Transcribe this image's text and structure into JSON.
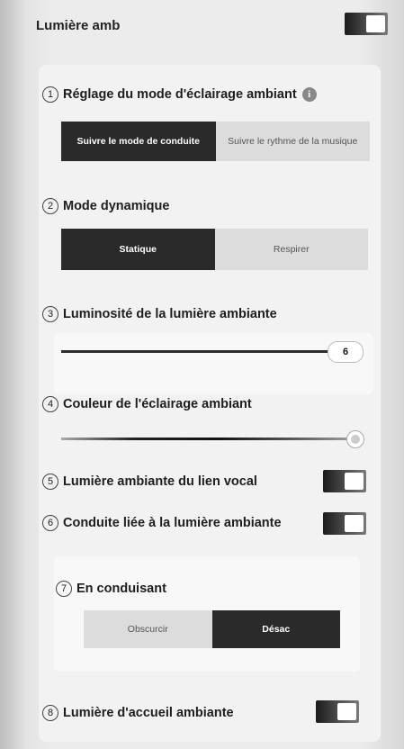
{
  "header": {
    "title": "Lumière amb",
    "toggle_on": true
  },
  "sections": {
    "s1": {
      "number": "1",
      "title": "Réglage du mode d'éclairage ambiant",
      "info_icon": "i",
      "options": [
        "Suivre le mode de conduite",
        "Suivre le rythme de la musique"
      ],
      "selected": 0
    },
    "s2": {
      "number": "2",
      "title": "Mode dynamique",
      "options": [
        "Statique",
        "Respirer"
      ],
      "selected": 0
    },
    "s3": {
      "number": "3",
      "title": "Luminosité de la lumière ambiante",
      "value": "6"
    },
    "s4": {
      "number": "4",
      "title": "Couleur de l'éclairage ambiant"
    },
    "s5": {
      "number": "5",
      "title": "Lumière ambiante du lien vocal",
      "toggle_on": true
    },
    "s6": {
      "number": "6",
      "title": "Conduite liée à la lumière ambiante",
      "toggle_on": true
    },
    "s7": {
      "number": "7",
      "title": "En conduisant",
      "options": [
        "Obscurcir",
        "Désac"
      ],
      "selected": 1
    },
    "s8": {
      "number": "8",
      "title": "Lumière d'accueil ambiante",
      "toggle_on": true
    }
  }
}
